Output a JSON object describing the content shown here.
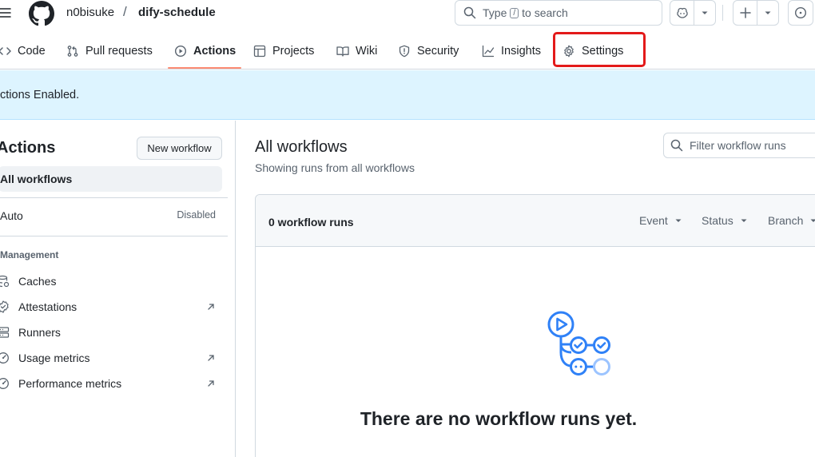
{
  "header": {
    "owner": "n0bisuke",
    "separator": "/",
    "repo": "dify-schedule",
    "search_pre": "Type",
    "search_key": "/",
    "search_post": "to search"
  },
  "tabs": [
    {
      "label": "Code",
      "icon": "code-icon"
    },
    {
      "label": "Pull requests",
      "icon": "pull-request-icon"
    },
    {
      "label": "Actions",
      "icon": "play-icon",
      "active": true
    },
    {
      "label": "Projects",
      "icon": "table-icon"
    },
    {
      "label": "Wiki",
      "icon": "book-icon"
    },
    {
      "label": "Security",
      "icon": "shield-icon"
    },
    {
      "label": "Insights",
      "icon": "graph-icon"
    },
    {
      "label": "Settings",
      "icon": "gear-icon",
      "highlighted": true
    }
  ],
  "banner": {
    "text": "ctions Enabled."
  },
  "sidebar": {
    "title": "Actions",
    "new_workflow": "New workflow",
    "all_workflows": "All workflows",
    "workflow": {
      "name": "Auto",
      "badge": "Disabled"
    },
    "management_heading": "Management",
    "items": [
      {
        "label": "Caches",
        "icon": "database-icon",
        "external": false
      },
      {
        "label": "Attestations",
        "icon": "verified-icon",
        "external": true
      },
      {
        "label": "Runners",
        "icon": "server-icon",
        "external": false
      },
      {
        "label": "Usage metrics",
        "icon": "meter-icon",
        "external": true
      },
      {
        "label": "Performance metrics",
        "icon": "meter-icon",
        "external": true
      }
    ]
  },
  "main": {
    "title": "All workflows",
    "subtitle": "Showing runs from all workflows",
    "filter_placeholder": "Filter workflow runs",
    "runs_count": "0 workflow runs",
    "filters": [
      "Event",
      "Status",
      "Branch"
    ],
    "empty_message": "There are no workflow runs yet."
  },
  "colors": {
    "accent_underline": "#fd8c73",
    "highlight_box": "#e31a1a",
    "banner_bg": "#ddf4ff",
    "illustration": "#2f81f7"
  }
}
